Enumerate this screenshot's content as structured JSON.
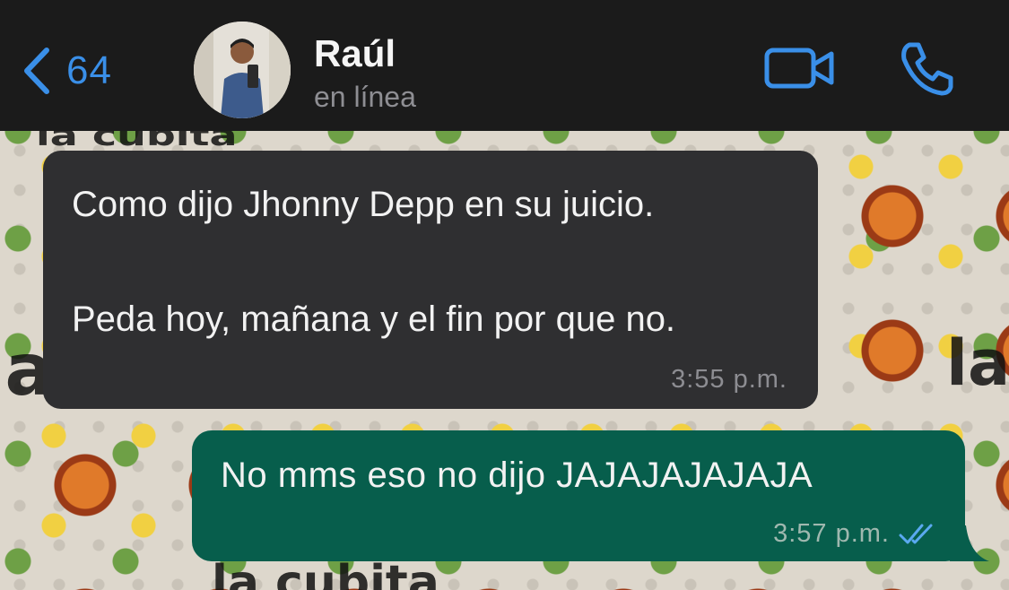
{
  "header": {
    "back_count": "64",
    "contact_name": "Raúl",
    "contact_status": "en línea",
    "icons": [
      "chevron-left-icon",
      "video-call-icon",
      "phone-icon"
    ],
    "accent_color": "#3a8fe8"
  },
  "wallpaper": {
    "texts": [
      "la",
      "la",
      "la cubita",
      "la cubita"
    ]
  },
  "messages": [
    {
      "direction": "incoming",
      "text": "Como dijo Jhonny Depp en su juicio.\n\nPeda hoy, mañana y el fin por que no.",
      "time": "3:55 p.m.",
      "bubble_color": "#2f2f31"
    },
    {
      "direction": "outgoing",
      "text": "No mms eso no dijo JAJAJAJAJAJA",
      "time": "3:57 p.m.",
      "status": "read",
      "status_icon": "double-check-icon",
      "bubble_color": "#075e4c"
    }
  ]
}
